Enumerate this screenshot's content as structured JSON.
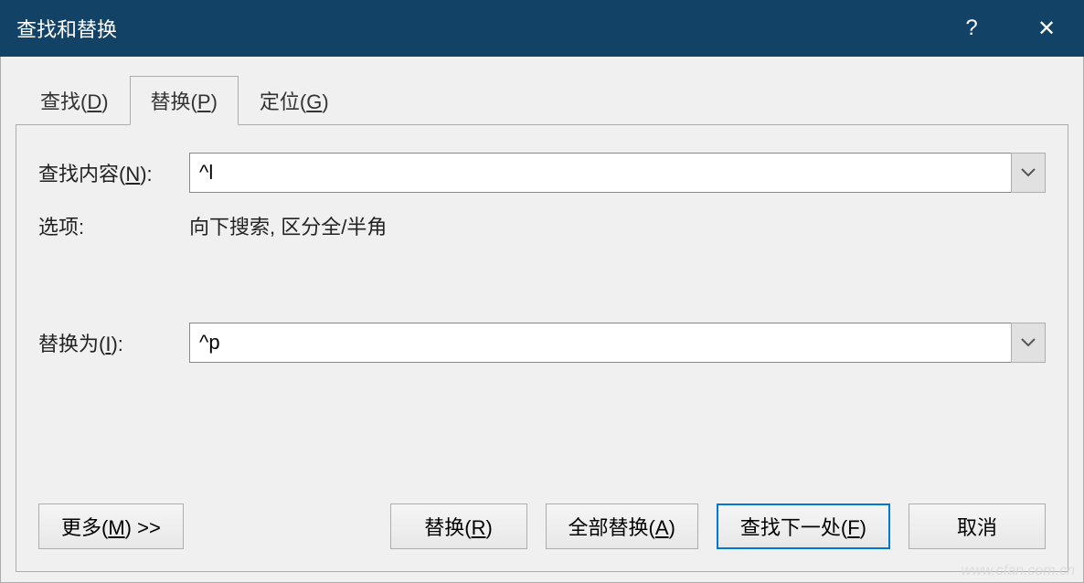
{
  "titlebar": {
    "title": "查找和替换",
    "help": "?",
    "close": "✕"
  },
  "tabs": {
    "find": {
      "label": "查找(",
      "accel": "D",
      "suffix": ")"
    },
    "replace": {
      "label": "替换(",
      "accel": "P",
      "suffix": ")"
    },
    "goto": {
      "label": "定位(",
      "accel": "G",
      "suffix": ")"
    }
  },
  "form": {
    "find_label": {
      "text": "查找内容(",
      "accel": "N",
      "suffix": "):"
    },
    "find_value": "^l",
    "options_label": "选项:",
    "options_value": "向下搜索, 区分全/半角",
    "replace_label": {
      "text": "替换为(",
      "accel": "I",
      "suffix": "):"
    },
    "replace_value": "^p"
  },
  "buttons": {
    "more": {
      "text": "更多(",
      "accel": "M",
      "suffix": ") >>"
    },
    "replace": {
      "text": "替换(",
      "accel": "R",
      "suffix": ")"
    },
    "replace_all": {
      "text": "全部替换(",
      "accel": "A",
      "suffix": ")"
    },
    "find_next": {
      "text": "查找下一处(",
      "accel": "F",
      "suffix": ")"
    },
    "cancel": "取消"
  },
  "watermark": "www.cfan.com.cn"
}
